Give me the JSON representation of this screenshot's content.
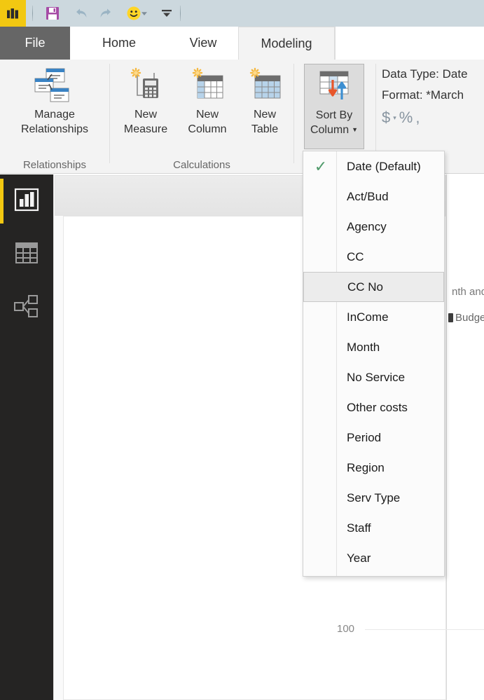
{
  "titlebar": {
    "logo_icon": "powerbi-logo-icon",
    "quick_access": [
      {
        "name": "save-button",
        "icon": "save-floppy-icon",
        "label": "Save"
      },
      {
        "name": "undo-button",
        "icon": "undo-arrow-icon",
        "label": "Undo"
      },
      {
        "name": "redo-button",
        "icon": "redo-arrow-icon",
        "label": "Redo"
      },
      {
        "name": "send-feedback-button",
        "icon": "smiley-face-icon",
        "label": "Send a Smile"
      },
      {
        "name": "customize-qat-button",
        "icon": "chevron-down-icon",
        "label": "Customize Quick Access Toolbar"
      }
    ]
  },
  "tabs": {
    "file": "File",
    "items": [
      {
        "label": "Home",
        "active": false
      },
      {
        "label": "View",
        "active": false
      },
      {
        "label": "Modeling",
        "active": true
      }
    ]
  },
  "ribbon": {
    "groups": [
      {
        "label": "Relationships",
        "buttons": [
          {
            "label_line1": "Manage",
            "label_line2": "Relationships",
            "icon": "manage-relationships-icon"
          }
        ]
      },
      {
        "label": "Calculations",
        "buttons": [
          {
            "label_line1": "New",
            "label_line2": "Measure",
            "icon": "new-measure-icon"
          },
          {
            "label_line1": "New",
            "label_line2": "Column",
            "icon": "new-column-icon"
          },
          {
            "label_line1": "New",
            "label_line2": "Table",
            "icon": "new-table-icon"
          }
        ]
      },
      {
        "label": "",
        "buttons": [
          {
            "label_line1": "Sort By",
            "label_line2": "Column",
            "icon": "sort-by-column-icon",
            "pressed": true,
            "has_caret": true
          }
        ]
      }
    ],
    "properties": {
      "data_type": "Data Type: Date",
      "format": "Format: *March",
      "format_buttons": [
        {
          "name": "currency-format-button",
          "glyph": "$"
        },
        {
          "name": "currency-dropdown-caret",
          "glyph": "▾"
        },
        {
          "name": "percent-format-button",
          "glyph": "%"
        },
        {
          "name": "thousands-separator-button",
          "glyph": ","
        }
      ]
    }
  },
  "sidebar": {
    "items": [
      {
        "name": "report-view",
        "icon": "bar-chart-icon",
        "label": "Report",
        "active": true
      },
      {
        "name": "data-view",
        "icon": "table-grid-icon",
        "label": "Data",
        "active": false
      },
      {
        "name": "model-view",
        "icon": "relationships-icon",
        "label": "Model",
        "active": false
      }
    ],
    "accent_color": "#f2c811"
  },
  "sort_menu": {
    "open": true,
    "items": [
      {
        "label": "Date (Default)",
        "checked": true,
        "hovered": false
      },
      {
        "label": "Act/Bud",
        "checked": false,
        "hovered": false
      },
      {
        "label": "Agency",
        "checked": false,
        "hovered": false
      },
      {
        "label": "CC",
        "checked": false,
        "hovered": false
      },
      {
        "label": "CC No",
        "checked": false,
        "hovered": true
      },
      {
        "label": "InCome",
        "checked": false,
        "hovered": false
      },
      {
        "label": "Month",
        "checked": false,
        "hovered": false
      },
      {
        "label": "No Service",
        "checked": false,
        "hovered": false
      },
      {
        "label": "Other costs",
        "checked": false,
        "hovered": false
      },
      {
        "label": "Period",
        "checked": false,
        "hovered": false
      },
      {
        "label": "Region",
        "checked": false,
        "hovered": false
      },
      {
        "label": "Serv Type",
        "checked": false,
        "hovered": false
      },
      {
        "label": "Staff",
        "checked": false,
        "hovered": false
      },
      {
        "label": "Year",
        "checked": false,
        "hovered": false
      }
    ],
    "check_glyph": "✓",
    "check_color": "#4f9a6a"
  },
  "canvas": {
    "chart_title_fragment": "nth and",
    "legend": [
      {
        "label": "Budget",
        "color": "#3d3d3d"
      }
    ],
    "axis_tick": "100"
  }
}
